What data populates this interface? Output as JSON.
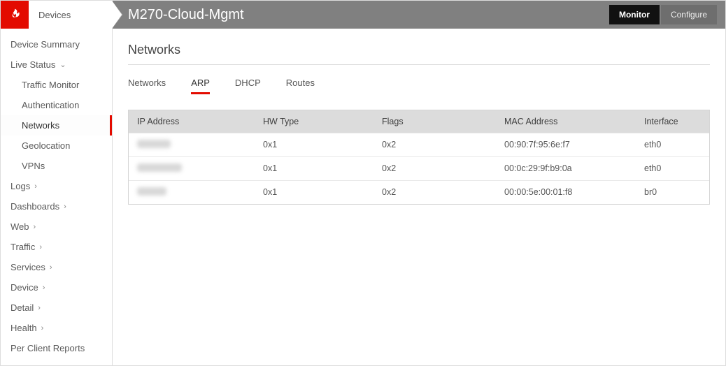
{
  "sidebar": {
    "top_tab": "Devices",
    "items": [
      {
        "label": "Device Summary",
        "sub": false,
        "expand": null
      },
      {
        "label": "Live Status",
        "sub": false,
        "expand": "down"
      },
      {
        "label": "Traffic Monitor",
        "sub": true,
        "expand": null
      },
      {
        "label": "Authentication",
        "sub": true,
        "expand": null
      },
      {
        "label": "Networks",
        "sub": true,
        "expand": null,
        "active": true
      },
      {
        "label": "Geolocation",
        "sub": true,
        "expand": null
      },
      {
        "label": "VPNs",
        "sub": true,
        "expand": null
      },
      {
        "label": "Logs",
        "sub": false,
        "expand": "right"
      },
      {
        "label": "Dashboards",
        "sub": false,
        "expand": "right"
      },
      {
        "label": "Web",
        "sub": false,
        "expand": "right"
      },
      {
        "label": "Traffic",
        "sub": false,
        "expand": "right"
      },
      {
        "label": "Services",
        "sub": false,
        "expand": "right"
      },
      {
        "label": "Device",
        "sub": false,
        "expand": "right"
      },
      {
        "label": "Detail",
        "sub": false,
        "expand": "right"
      },
      {
        "label": "Health",
        "sub": false,
        "expand": "right"
      },
      {
        "label": "Per Client Reports",
        "sub": false,
        "expand": null
      }
    ]
  },
  "topbar": {
    "device_title": "M270-Cloud-Mgmt",
    "monitor_label": "Monitor",
    "configure_label": "Configure"
  },
  "page": {
    "heading": "Networks",
    "tabs": [
      "Networks",
      "ARP",
      "DHCP",
      "Routes"
    ],
    "active_tab": "ARP"
  },
  "table": {
    "columns": [
      "IP Address",
      "HW Type",
      "Flags",
      "MAC Address",
      "Interface"
    ],
    "rows": [
      {
        "ip_blur_w": 48,
        "hw": "0x1",
        "flags": "0x2",
        "mac": "00:90:7f:95:6e:f7",
        "iface": "eth0"
      },
      {
        "ip_blur_w": 64,
        "hw": "0x1",
        "flags": "0x2",
        "mac": "00:0c:29:9f:b9:0a",
        "iface": "eth0"
      },
      {
        "ip_blur_w": 42,
        "hw": "0x1",
        "flags": "0x2",
        "mac": "00:00:5e:00:01:f8",
        "iface": "br0"
      }
    ]
  }
}
